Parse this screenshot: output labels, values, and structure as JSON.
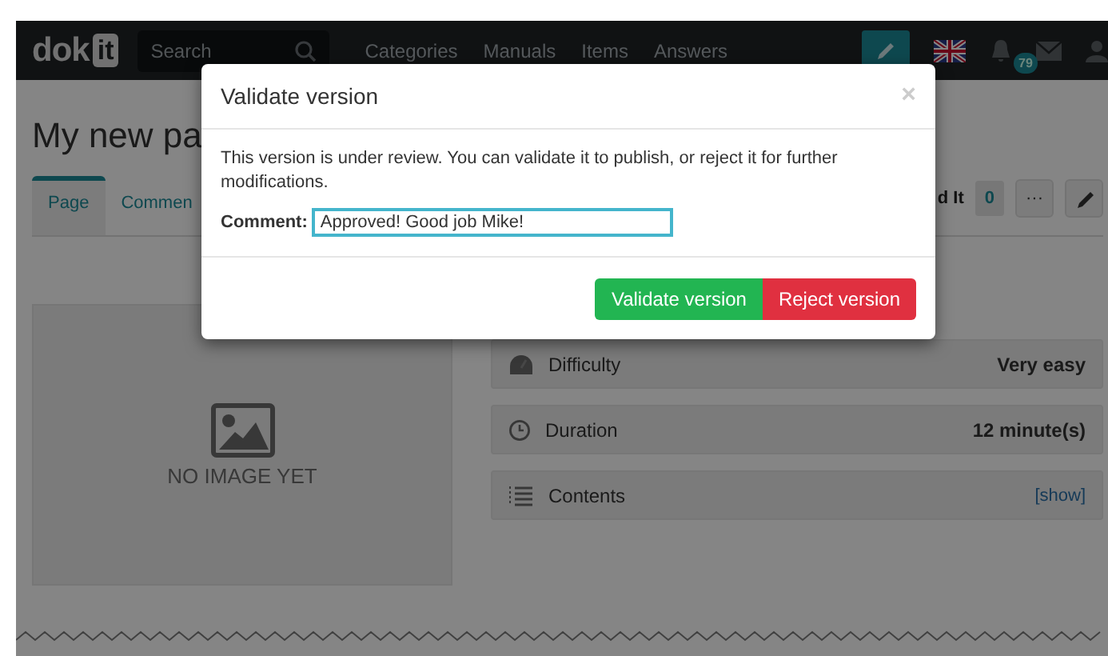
{
  "navbar": {
    "logo": {
      "text": "dok",
      "boxed": "it"
    },
    "search": {
      "placeholder": "Search"
    },
    "links": [
      "Categories",
      "Manuals",
      "Items",
      "Answers"
    ],
    "notification_count": "79"
  },
  "page": {
    "title": "My new pa",
    "tabs": [
      {
        "label": "Page",
        "selected": true
      },
      {
        "label": "Commen",
        "selected": false
      }
    ],
    "toolbar": {
      "did_it_label": "d It",
      "did_it_count": "0",
      "more_label": "···"
    },
    "image_placeholder": "NO IMAGE YET",
    "properties": [
      {
        "kind": "difficulty",
        "label": "Difficulty",
        "value": "Very easy"
      },
      {
        "kind": "duration",
        "label": "Duration",
        "value": "12 minute(s)"
      },
      {
        "kind": "contents",
        "label": "Contents",
        "link": "[show]"
      }
    ]
  },
  "modal": {
    "title": "Validate version",
    "close": "×",
    "message": "This version is under review. You can validate it to publish, or reject it for further modifications.",
    "comment_label": "Comment:",
    "comment_value": "Approved! Good job Mike!",
    "buttons": [
      {
        "kind": "validate",
        "label": "Validate version"
      },
      {
        "kind": "reject",
        "label": "Reject version"
      }
    ]
  }
}
